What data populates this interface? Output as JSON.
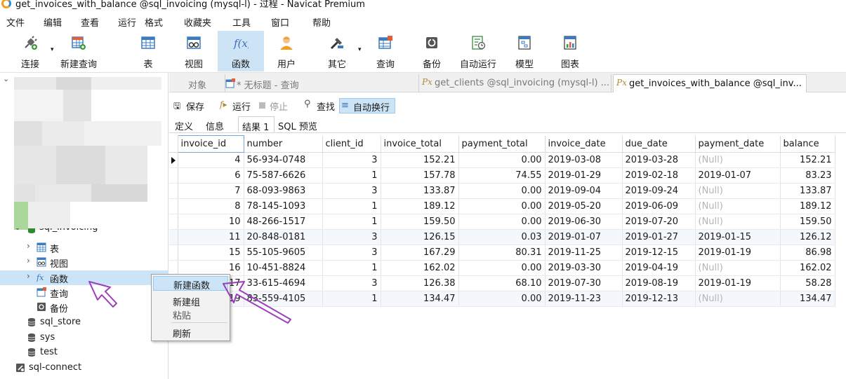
{
  "window": {
    "title": "get_invoices_with_balance @sql_invoicing (mysql-l) - 过程 - Navicat Premium"
  },
  "menu": [
    "文件",
    "编辑",
    "查看",
    "运行",
    "格式",
    "收藏夹",
    "工具",
    "窗口",
    "帮助"
  ],
  "toolbar": {
    "items": [
      {
        "label": "连接",
        "icon": "plug-icon"
      },
      {
        "label": "新建查询",
        "icon": "new-query-icon"
      },
      {
        "label": "表",
        "icon": "table-icon"
      },
      {
        "label": "视图",
        "icon": "view-icon"
      },
      {
        "label": "函数",
        "icon": "function-icon",
        "active": true
      },
      {
        "label": "用户",
        "icon": "user-icon"
      },
      {
        "label": "其它",
        "icon": "tools-icon"
      },
      {
        "label": "查询",
        "icon": "query-icon"
      },
      {
        "label": "备份",
        "icon": "backup-icon"
      },
      {
        "label": "自动运行",
        "icon": "schedule-icon"
      },
      {
        "label": "模型",
        "icon": "model-icon"
      },
      {
        "label": "图表",
        "icon": "chart-icon"
      }
    ]
  },
  "sidebar": {
    "db_partial": "sql_invoicing",
    "tree": [
      {
        "label": "表",
        "icon": "table-icon",
        "chevron": true
      },
      {
        "label": "视图",
        "icon": "view-icon",
        "chevron": true
      },
      {
        "label": "函数",
        "icon": "function-icon",
        "chevron": true,
        "selected": true
      },
      {
        "label": "查询",
        "icon": "query-icon",
        "chevron": false
      },
      {
        "label": "备份",
        "icon": "backup-icon",
        "chevron": false
      }
    ],
    "databases": [
      "sql_store",
      "sys",
      "test"
    ],
    "connection": "sql-connect"
  },
  "context_menu": {
    "items": [
      "新建函数",
      "新建组",
      "粘贴",
      "刷新"
    ]
  },
  "tabs": [
    {
      "label": "对象"
    },
    {
      "label": "* 无标题 - 查询"
    },
    {
      "label": "get_clients @sql_invoicing (mysql-l) ..."
    },
    {
      "label": "get_invoices_with_balance @sql_inv..."
    }
  ],
  "editor_toolbar": {
    "save": "保存",
    "run": "运行",
    "stop": "停止",
    "find": "查找",
    "wrap": "自动换行"
  },
  "result_tabs": [
    "定义",
    "信息",
    "结果 1",
    "SQL 预览"
  ],
  "grid": {
    "columns": [
      "invoice_id",
      "number",
      "client_id",
      "invoice_total",
      "payment_total",
      "invoice_date",
      "due_date",
      "payment_date",
      "balance"
    ],
    "rows": [
      [
        "4",
        "56-934-0748",
        "3",
        "152.21",
        "0.00",
        "2019-03-08",
        "2019-03-28",
        "(Null)",
        "152.21"
      ],
      [
        "6",
        "75-587-6626",
        "1",
        "157.78",
        "74.55",
        "2019-01-29",
        "2019-02-18",
        "2019-01-07",
        "83.23"
      ],
      [
        "7",
        "68-093-9863",
        "3",
        "133.87",
        "0.00",
        "2019-09-04",
        "2019-09-24",
        "(Null)",
        "133.87"
      ],
      [
        "8",
        "78-145-1093",
        "1",
        "189.12",
        "0.00",
        "2019-05-20",
        "2019-06-09",
        "(Null)",
        "189.12"
      ],
      [
        "10",
        "48-266-1517",
        "1",
        "159.50",
        "0.00",
        "2019-06-30",
        "2019-07-20",
        "(Null)",
        "159.50"
      ],
      [
        "11",
        "20-848-0181",
        "3",
        "126.15",
        "0.03",
        "2019-01-07",
        "2019-01-27",
        "2019-01-15",
        "126.12"
      ],
      [
        "15",
        "55-105-9605",
        "3",
        "167.29",
        "80.31",
        "2019-11-25",
        "2019-12-15",
        "2019-01-19",
        "86.98"
      ],
      [
        "16",
        "10-451-8824",
        "1",
        "162.02",
        "0.00",
        "2019-03-30",
        "2019-04-19",
        "(Null)",
        "162.02"
      ],
      [
        "17",
        "33-615-4694",
        "3",
        "126.38",
        "68.10",
        "2019-07-30",
        "2019-08-19",
        "2019-01-19",
        "58.28"
      ],
      [
        "19",
        "83-559-4105",
        "1",
        "134.47",
        "0.00",
        "2019-11-23",
        "2019-12-13",
        "(Null)",
        "134.47"
      ]
    ]
  },
  "colors": {
    "selection": "#cce4f7",
    "annotation_arrow": "#9b3fb8",
    "null_text": "#b5b5b5"
  }
}
